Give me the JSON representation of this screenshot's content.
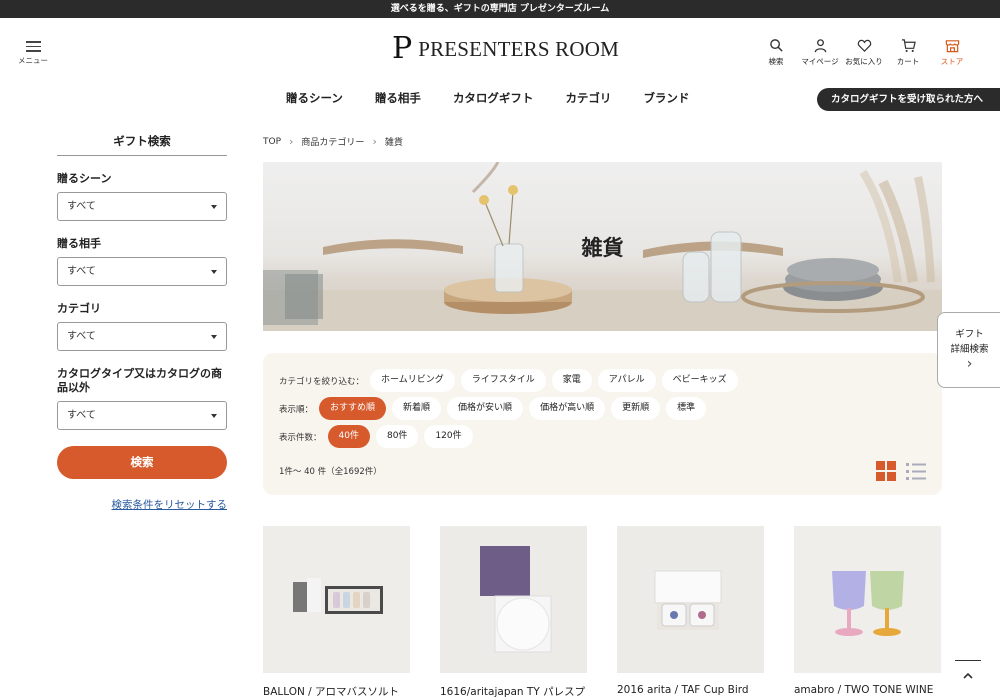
{
  "announcement": "選べるを贈る、ギフトの専門店 プレゼンターズルーム",
  "header": {
    "menu_label": "メニュー",
    "logo_mark": "P",
    "logo_text": "PRESENTERS ROOM",
    "icons": [
      {
        "label": "検索",
        "icon": "search-icon"
      },
      {
        "label": "マイページ",
        "icon": "user-icon"
      },
      {
        "label": "お気に入り",
        "icon": "heart-icon"
      },
      {
        "label": "カート",
        "icon": "cart-icon"
      },
      {
        "label": "ストア",
        "icon": "store-icon"
      }
    ]
  },
  "nav": {
    "items": [
      "贈るシーン",
      "贈る相手",
      "カタログギフト",
      "カテゴリ",
      "ブランド"
    ],
    "receive_button": "カタログギフトを受け取られた方へ"
  },
  "sidebar": {
    "title": "ギフト検索",
    "fields": [
      {
        "label": "贈るシーン",
        "value": "すべて"
      },
      {
        "label": "贈る相手",
        "value": "すべて"
      },
      {
        "label": "カテゴリ",
        "value": "すべて"
      },
      {
        "label": "カタログタイプ又はカタログの商品以外",
        "value": "すべて"
      }
    ],
    "search_button": "検索",
    "reset_link": "検索条件をリセットする"
  },
  "breadcrumb": [
    "TOP",
    "商品カテゴリー",
    "雑貨"
  ],
  "hero": {
    "title": "雑貨"
  },
  "filters": {
    "category_label": "カテゴリを絞り込む：",
    "categories": [
      "ホームリビング",
      "ライフスタイル",
      "家電",
      "アパレル",
      "ベビーキッズ"
    ],
    "sort_label": "表示順：",
    "sort_options": [
      "おすすめ順",
      "新着順",
      "価格が安い順",
      "価格が高い順",
      "更新順",
      "標準"
    ],
    "sort_selected": 0,
    "per_page_label": "表示件数：",
    "per_page_options": [
      "40件",
      "80件",
      "120件"
    ],
    "per_page_selected": 0,
    "count_text": "1件〜 40 件（全1692件）",
    "active_view": "grid"
  },
  "side_tab": {
    "line1": "ギフト",
    "line2": "詳細検索",
    "arrow": "›"
  },
  "products": [
    {
      "name": "BALLON / アロマバスソルト"
    },
    {
      "name": "1616/aritajapan TY パレスプ"
    },
    {
      "name": "2016 arita / TAF Cup Bird"
    },
    {
      "name": "amabro / TWO TONE WINE"
    }
  ],
  "colors": {
    "accent": "#d65a2c",
    "dark": "#2b2b2b",
    "filter_bg": "#f8f5ef",
    "link": "#2a5aa0"
  }
}
